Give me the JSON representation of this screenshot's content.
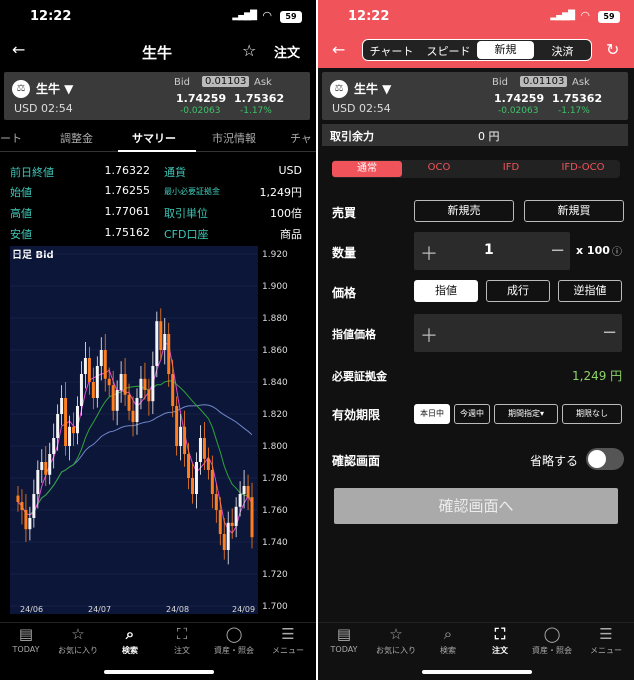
{
  "status": {
    "time": "12:22",
    "battery": "59"
  },
  "left": {
    "title": "生牛",
    "order_label": "注文",
    "quote": {
      "name": "生牛 ▼",
      "currency_time": "USD 02:54",
      "bid_label": "Bid",
      "spread": "0.01103",
      "ask_label": "Ask",
      "bid": "1.74259",
      "ask": "1.75362",
      "change": "-0.02063",
      "change_pct": "-1.17%"
    },
    "tabs": [
      "ート",
      "調整金",
      "サマリー",
      "市況情報",
      "チャ"
    ],
    "stats": [
      {
        "label": "前日終値",
        "value": "1.76322"
      },
      {
        "label": "始値",
        "value": "1.76255"
      },
      {
        "label": "高値",
        "value": "1.77061"
      },
      {
        "label": "安値",
        "value": "1.75162"
      }
    ],
    "stats_right": [
      {
        "label": "通貨",
        "value": "USD"
      },
      {
        "label": "最小必要証拠金",
        "value": "1,249円"
      },
      {
        "label": "取引単位",
        "value": "100倍"
      },
      {
        "label": "CFD口座",
        "value": "商品"
      }
    ],
    "chart_title": "日足 Bid",
    "y_ticks": [
      "1.920",
      "1.900",
      "1.880",
      "1.860",
      "1.840",
      "1.820",
      "1.800",
      "1.780",
      "1.760",
      "1.740",
      "1.720",
      "1.700"
    ],
    "x_ticks": [
      "24/06",
      "24/07",
      "24/08",
      "24/09"
    ]
  },
  "right": {
    "quote": {
      "name": "生牛 ▼",
      "currency_time": "USD 02:54",
      "bid_label": "Bid",
      "spread": "0.01103",
      "ask_label": "Ask",
      "bid": "1.74259",
      "ask": "1.75362",
      "change": "-0.02063",
      "change_pct": "-1.17%"
    },
    "segments": [
      "チャート",
      "スピード",
      "新規",
      "決済"
    ],
    "available_label": "取引余力",
    "available_value": "0 円",
    "order_types": [
      "通常",
      "OCO",
      "IFD",
      "IFD-OCO"
    ],
    "side_label": "売買",
    "sell_label": "新規売",
    "buy_label": "新規買",
    "qty_label": "数量",
    "qty_value": "1",
    "qty_unit": "x 100",
    "price_label": "価格",
    "price_types": [
      "指値",
      "成行",
      "逆指値"
    ],
    "limit_price_label": "指値価格",
    "margin_label": "必要証拠金",
    "margin_value": "1,249 円",
    "expiry_label": "有効期限",
    "expiry_options": [
      "本日中",
      "今週中",
      "期間指定▾",
      "期限なし"
    ],
    "confirm_screen_label": "確認画面",
    "skip_label": "省略する",
    "confirm_button": "確認画面へ"
  },
  "tabbar": [
    "TODAY",
    "お気に入り",
    "検索",
    "注文",
    "資産・照会",
    "メニュー"
  ],
  "chart_data": {
    "type": "candlestick",
    "title": "日足 Bid",
    "ylim": [
      1.7,
      1.92
    ],
    "x_ticks": [
      "24/06",
      "24/07",
      "24/08",
      "24/09"
    ],
    "closes": [
      1.765,
      1.76,
      1.748,
      1.755,
      1.77,
      1.785,
      1.79,
      1.782,
      1.795,
      1.805,
      1.82,
      1.83,
      1.8,
      1.812,
      1.808,
      1.825,
      1.845,
      1.855,
      1.84,
      1.83,
      1.85,
      1.86,
      1.842,
      1.838,
      1.822,
      1.835,
      1.845,
      1.832,
      1.822,
      1.815,
      1.83,
      1.842,
      1.835,
      1.828,
      1.85,
      1.878,
      1.86,
      1.87,
      1.845,
      1.825,
      1.8,
      1.812,
      1.795,
      1.78,
      1.77,
      1.79,
      1.805,
      1.792,
      1.785,
      1.77,
      1.76,
      1.745,
      1.735,
      1.752,
      1.75,
      1.762,
      1.77,
      1.775,
      1.768,
      1.743
    ]
  }
}
